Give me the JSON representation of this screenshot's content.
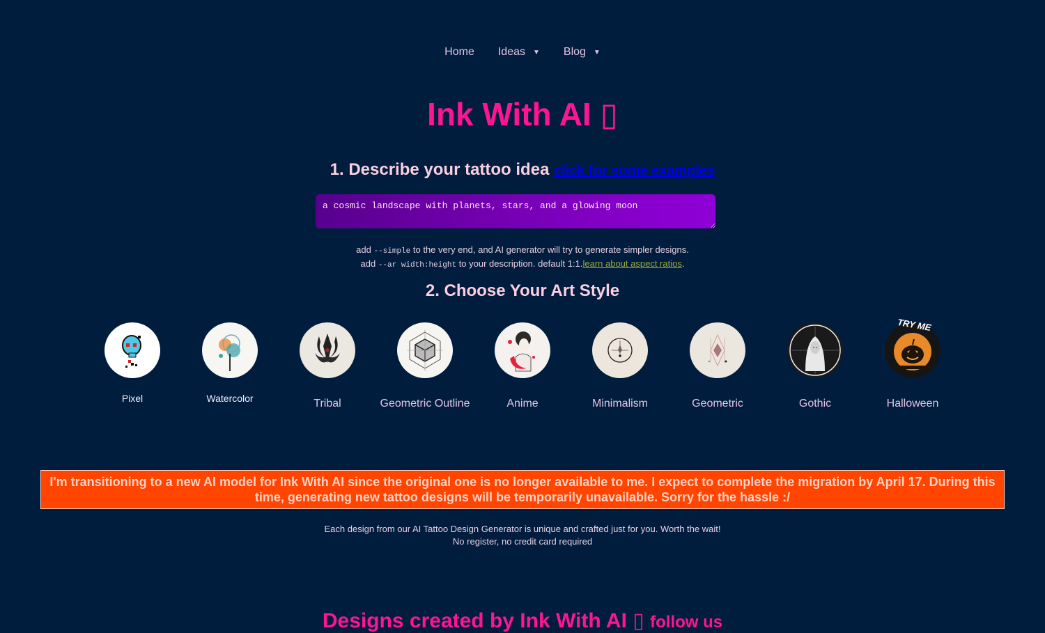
{
  "nav": {
    "items": [
      {
        "label": "Home",
        "has_dropdown": false
      },
      {
        "label": "Ideas",
        "has_dropdown": true
      },
      {
        "label": "Blog",
        "has_dropdown": true
      }
    ],
    "caret": "▼"
  },
  "header": {
    "title": "Ink With AI",
    "title_glyph": "▯"
  },
  "step1": {
    "heading": "1. Describe your tattoo idea",
    "examples_link": "click for some examples",
    "prompt_value": "a cosmic landscape with planets, stars, and a glowing moon",
    "hint1_pre": "add",
    "hint1_code": "--simple",
    "hint1_post": "to the very end, and AI generator will try to generate simpler designs.",
    "hint2_pre": "add",
    "hint2_code": "--ar width:height",
    "hint2_post": "to your description. default 1:1.",
    "hint2_link": "learn about aspect ratios",
    "hint2_end": "."
  },
  "step2": {
    "heading": "2. Choose Your Art Style",
    "styles": [
      {
        "label": "Pixel",
        "icon": "pixel-skull-icon"
      },
      {
        "label": "Watercolor",
        "icon": "watercolor-splash-icon"
      },
      {
        "label": "Tribal",
        "icon": "tribal-emblem-icon"
      },
      {
        "label": "Geometric Outline",
        "icon": "geometric-cube-icon"
      },
      {
        "label": "Anime",
        "icon": "anime-girl-icon"
      },
      {
        "label": "Minimalism",
        "icon": "minimal-compass-icon"
      },
      {
        "label": "Geometric",
        "icon": "geometric-diamond-icon"
      },
      {
        "label": "Gothic",
        "icon": "gothic-woman-icon"
      },
      {
        "label": "Halloween",
        "icon": "halloween-pumpkin-icon",
        "badge": "TRY ME"
      }
    ]
  },
  "banner": {
    "text": "I'm transitioning to a new AI model for Ink With AI since the original one is no longer available to me. I expect to complete the migration by April 17. During this time, generating new tattoo designs will be temporarily unavailable. Sorry for the hassle :/"
  },
  "tagline": {
    "line1": "Each design from our AI Tattoo Design Generator is unique and crafted just for you. Worth the wait!",
    "line2": "No register, no credit card required"
  },
  "designs": {
    "heading": "Designs created by Ink With AI",
    "glyph": "▯",
    "follow_link": "follow us"
  },
  "colors": {
    "background": "#001d3d",
    "accent_pink": "#ff1493",
    "banner": "#ff4500",
    "link_blue": "#0000ee"
  }
}
